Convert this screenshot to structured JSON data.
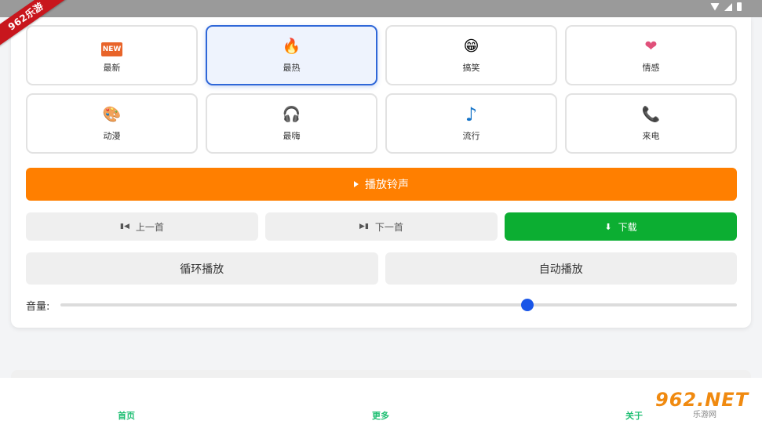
{
  "status_bar": {
    "icons": [
      "wifi-icon",
      "signal-icon",
      "battery-icon"
    ]
  },
  "ribbon": {
    "text": "962乐游"
  },
  "categories": [
    {
      "label": "最新",
      "icon": "NEW",
      "active": false
    },
    {
      "label": "最热",
      "icon": "🔥",
      "active": true
    },
    {
      "label": "搞笑",
      "icon": "😁",
      "active": false
    },
    {
      "label": "情感",
      "icon": "❤",
      "active": false
    },
    {
      "label": "动漫",
      "icon": "🎨",
      "active": false
    },
    {
      "label": "最嗨",
      "icon": "🎧",
      "active": false
    },
    {
      "label": "流行",
      "icon": "♪",
      "active": false
    },
    {
      "label": "来电",
      "icon": "📞",
      "active": false
    }
  ],
  "player": {
    "play_label": "播放铃声",
    "prev_label": "上一首",
    "next_label": "下一首",
    "download_label": "下载",
    "loop_label": "循环播放",
    "autoplay_label": "自动播放",
    "volume_label": "音量:",
    "volume_value": 0.69
  },
  "colors": {
    "play": "#ff7f00",
    "download": "#0cae32",
    "active_border": "#2f67d8",
    "slider": "#1a56e8",
    "nav": "#1fbf73"
  },
  "bottom_nav": {
    "items": [
      "首页",
      "更多",
      "关于"
    ]
  },
  "watermark": {
    "main": "962.NET",
    "sub": "乐游网"
  }
}
